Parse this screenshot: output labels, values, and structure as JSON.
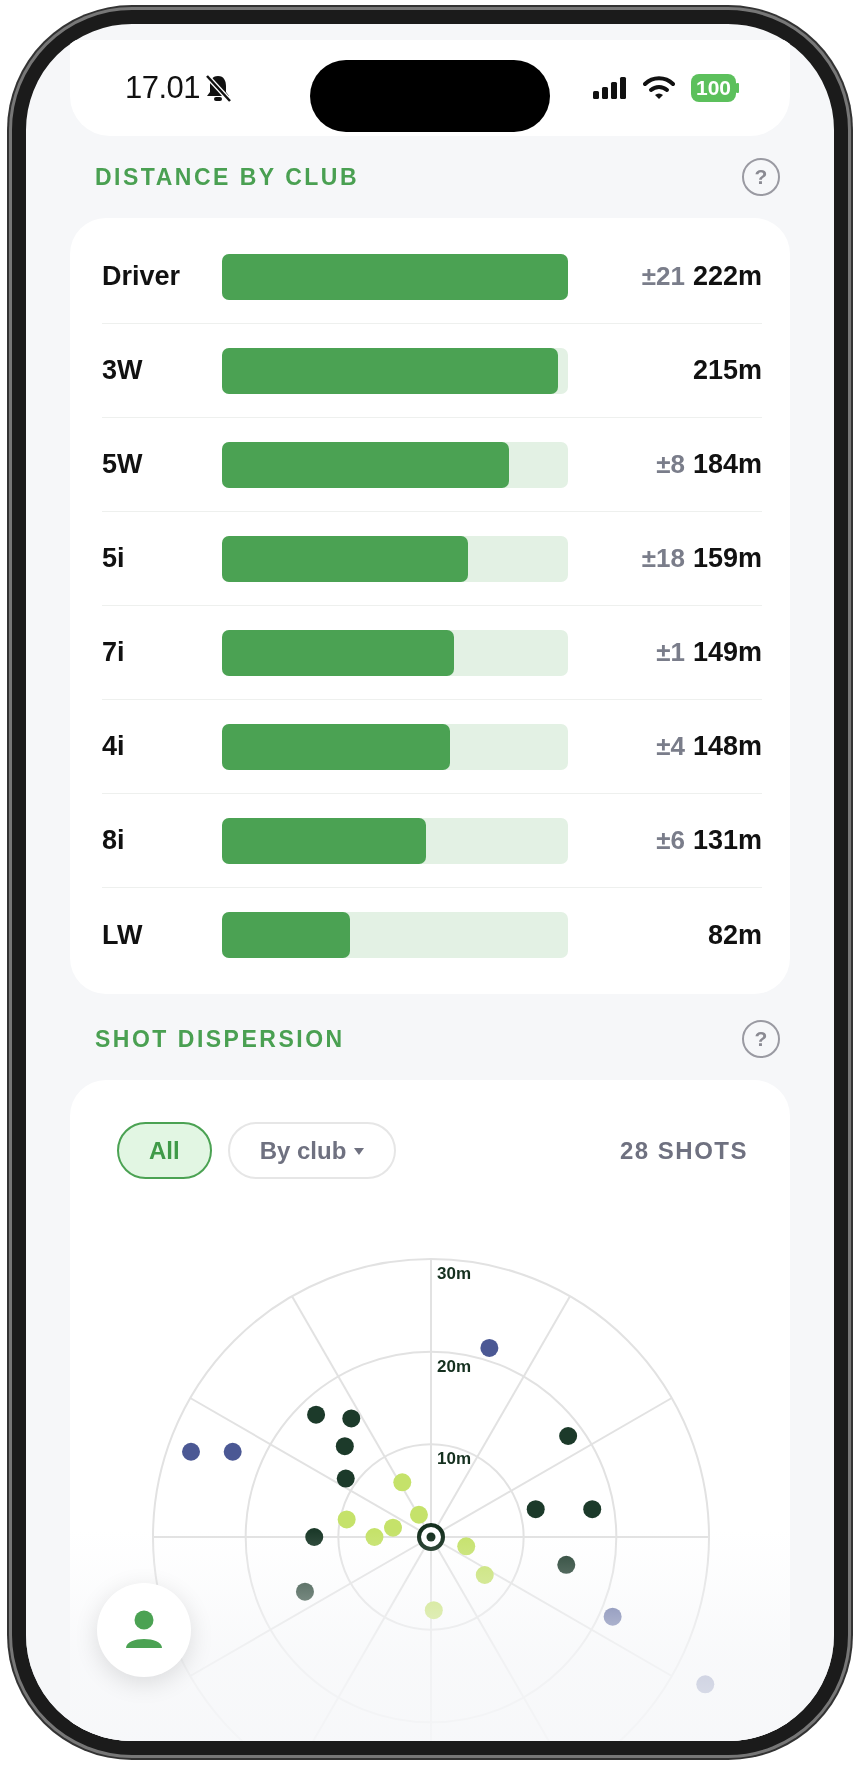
{
  "status_bar": {
    "time": "17.01",
    "muted": true,
    "battery": "100"
  },
  "sections": [
    {
      "title": "DISTANCE BY CLUB",
      "help": "?"
    },
    {
      "title": "SHOT DISPERSION",
      "help": "?"
    }
  ],
  "clubs": [
    {
      "name": "Driver",
      "level": 1.0,
      "spread": "±21",
      "distance": "222m"
    },
    {
      "name": "3W",
      "level": 0.97,
      "distance": "215m"
    },
    {
      "name": "5W",
      "level": 0.83,
      "spread": "±8",
      "distance": "184m"
    },
    {
      "name": "5i",
      "level": 0.71,
      "spread": "±18",
      "distance": "159m"
    },
    {
      "name": "7i",
      "level": 0.67,
      "spread": "±1",
      "distance": "149m"
    },
    {
      "name": "4i",
      "level": 0.66,
      "spread": "±4",
      "distance": "148m"
    },
    {
      "name": "8i",
      "level": 0.59,
      "spread": "±6",
      "distance": "131m"
    },
    {
      "name": "LW",
      "level": 0.37,
      "distance": "82m"
    }
  ],
  "filters": [
    {
      "label": "All",
      "selected": true,
      "has_menu": false
    },
    {
      "label": "By club",
      "selected": false,
      "has_menu": true
    }
  ],
  "shot_count": "28 SHOTS",
  "dispersion": {
    "ring_labels": [
      "30m",
      "20m",
      "10m"
    ]
  }
}
